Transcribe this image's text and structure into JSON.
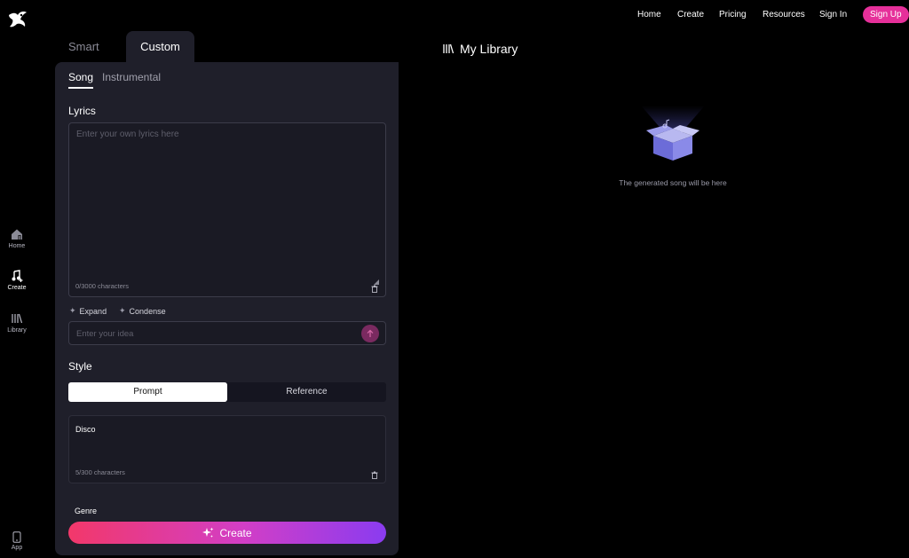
{
  "rail": {
    "items": [
      {
        "label": "Home",
        "icon": "home-icon"
      },
      {
        "label": "Create",
        "icon": "create-music-icon"
      },
      {
        "label": "Library",
        "icon": "library-icon"
      }
    ],
    "app_label": "App"
  },
  "nav": {
    "links": [
      "Home",
      "Create",
      "Pricing",
      "Resources",
      "Sign In"
    ],
    "signup": "Sign Up"
  },
  "mode_tabs": {
    "smart": "Smart",
    "custom": "Custom"
  },
  "sub_tabs": {
    "song": "Song",
    "instrumental": "Instrumental"
  },
  "lyrics": {
    "title": "Lyrics",
    "placeholder": "Enter your own lyrics here",
    "count": "0/3000 characters"
  },
  "lyric_tools": {
    "expand": "Expand",
    "condense": "Condense"
  },
  "idea": {
    "placeholder": "Enter your idea"
  },
  "style": {
    "title": "Style",
    "options": [
      "Prompt",
      "Reference"
    ],
    "value": "Disco",
    "count": "5/300 characters"
  },
  "genre_label": "Genre",
  "create_label": "Create",
  "library": {
    "title": "My Library",
    "empty_text": "The generated song will be here"
  },
  "colors": {
    "accent": "#e6309a",
    "panel": "#1f1f2a",
    "background": "#000000"
  }
}
